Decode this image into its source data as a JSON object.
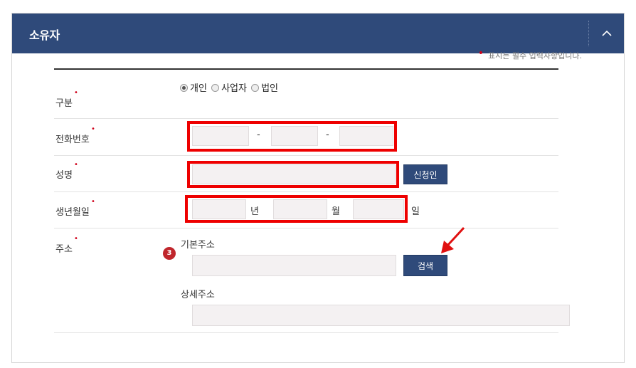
{
  "panel": {
    "title": "소유자",
    "collapse_icon": "chevron-up-icon"
  },
  "required_note": "표시는 필수 입력사항입니다.",
  "required_mark": "•",
  "fields": {
    "type": {
      "label": "구분",
      "options": [
        "개인",
        "사업자",
        "법인"
      ],
      "selected": "개인"
    },
    "phone": {
      "label": "전화번호",
      "separator1": "-",
      "separator2": "-",
      "values": [
        "",
        "",
        ""
      ]
    },
    "name": {
      "label": "성명",
      "value": "",
      "button": "신청인"
    },
    "birth": {
      "label": "생년월일",
      "year_unit": "년",
      "month_unit": "월",
      "day_unit": "일"
    },
    "address": {
      "label": "주소",
      "basic_label": "기본주소",
      "search_button": "검색",
      "detail_label": "상세주소"
    }
  },
  "annotations": {
    "step_number": "3",
    "highlight_color": "#ee0000",
    "arrow_color": "#e01010"
  },
  "colors": {
    "header_bg": "#2f4a7a",
    "required": "#d0021b",
    "input_bg": "#f4f1f2"
  }
}
